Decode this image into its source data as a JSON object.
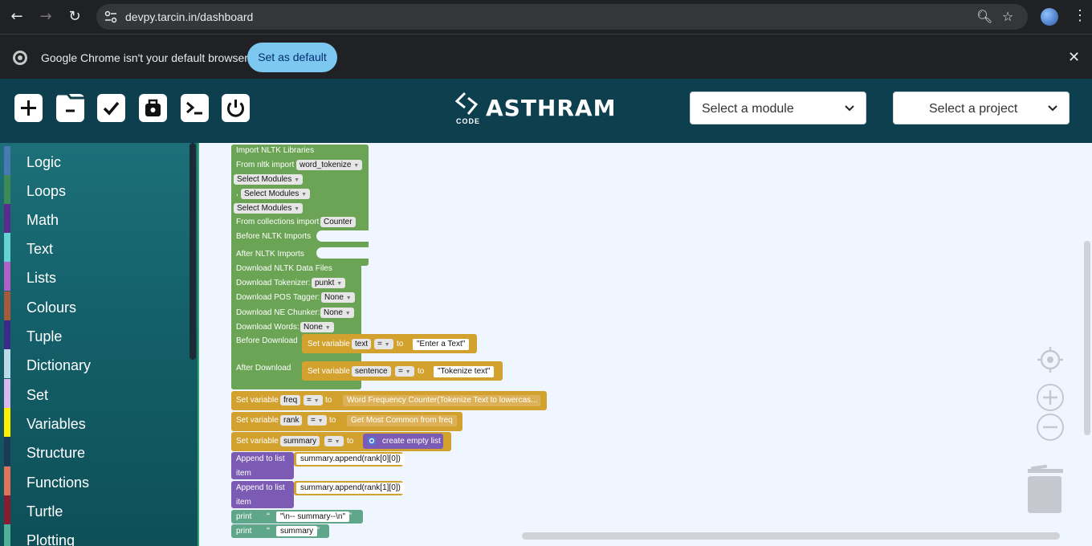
{
  "browser": {
    "url": "devpy.tarcin.in/dashboard",
    "back_icon": "arrow-left-icon",
    "forward_icon": "arrow-right-icon",
    "reload_icon": "reload-icon"
  },
  "infobar": {
    "message": "Google Chrome isn't your default browser",
    "button": "Set as default"
  },
  "header": {
    "logo_text": "ASTHRAM",
    "logo_sub": "CODE",
    "module_select": "Select a module",
    "project_select": "Select a project",
    "tools": [
      "new-file-icon",
      "remove-file-icon",
      "check-icon",
      "save-bag-icon",
      "terminal-icon",
      "power-icon"
    ]
  },
  "sidebar": {
    "categories": [
      {
        "label": "Logic",
        "color": "#4a78b4"
      },
      {
        "label": "Loops",
        "color": "#3d8a57"
      },
      {
        "label": "Math",
        "color": "#5a2a8e"
      },
      {
        "label": "Text",
        "color": "#66d3d3"
      },
      {
        "label": "Lists",
        "color": "#b15fc9"
      },
      {
        "label": "Colours",
        "color": "#a65a3a"
      },
      {
        "label": "Tuple",
        "color": "#3a2a8a"
      },
      {
        "label": "Dictionary",
        "color": "#b9dbe8"
      },
      {
        "label": "Set",
        "color": "#d9b8ee"
      },
      {
        "label": "Variables",
        "color": "#ffee00"
      },
      {
        "label": "Structure",
        "color": "#1c3a55"
      },
      {
        "label": "Functions",
        "color": "#e2735a"
      },
      {
        "label": "Turtle",
        "color": "#8a1a30"
      },
      {
        "label": "Plotting",
        "color": "#4fb09a"
      }
    ]
  },
  "blocks": {
    "import_header": "Import NLTK Libraries",
    "from_nltk": "From nltk import",
    "word_tokenize": "word_tokenize",
    "select_modules": "Select Modules",
    "comma": ",",
    "from_collections": "From collections import",
    "counter": "Counter",
    "before_imports": "Before NLTK Imports",
    "after_imports": "After NLTK Imports",
    "download_header": "Download NLTK Data Files",
    "download_tokenizer": "Download Tokenizer:",
    "punkt": "punkt",
    "download_pos": "Download POS Tagger:",
    "download_ne": "Download NE Chunker:",
    "download_words": "Download Words:",
    "none": "None",
    "before_download": "Before Download",
    "after_download": "After Download",
    "set_variable": "Set variable",
    "to": "to",
    "eq": "=",
    "var_text": "text",
    "var_sentence": "sentence",
    "var_freq": "freq",
    "var_rank": "rank",
    "var_summary": "summary",
    "val_enter_text": "\"Enter a Text\"",
    "val_tokenize_text": "\"Tokenize text\"",
    "val_word_freq": "Word Frequency Counter(Tokenize Text to lowercas...",
    "val_most_common": "Get Most Common from freq",
    "val_empty_list": "create empty list",
    "append_to_list": "Append to list",
    "item": "item",
    "append1": "summary.append(rank[0][0])",
    "append2": "summary.append(rank[1][0])",
    "print": "print",
    "print_val1": "\"\\n-- summary--\\n\"",
    "print_val2": "summary",
    "open_quote": "“",
    "close_quote": "”"
  }
}
